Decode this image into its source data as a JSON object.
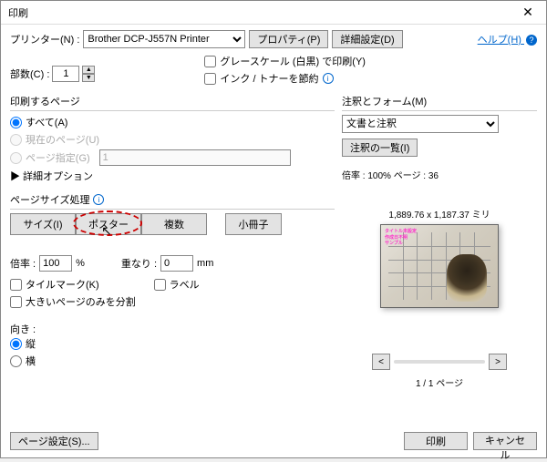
{
  "title": "印刷",
  "printer": {
    "label": "プリンター(N) :",
    "selected": "Brother DCP-J557N Printer",
    "props_btn": "プロパティ(P)",
    "adv_btn": "詳細設定(D)",
    "help": "ヘルプ(H)",
    "help_icon": "?"
  },
  "copies": {
    "label": "部数(C) :",
    "value": "1"
  },
  "options": {
    "grayscale": "グレースケール (白黒) で印刷(Y)",
    "save_ink": "インク / トナーを節約"
  },
  "pages": {
    "title": "印刷するページ",
    "all": "すべて(A)",
    "current": "現在のページ(U)",
    "range": "ページ指定(G)",
    "range_val": "1",
    "more": "▶ 詳細オプション"
  },
  "sizing": {
    "title": "ページサイズ処理",
    "size": "サイズ(I)",
    "poster": "ポスター",
    "multiple": "複数",
    "booklet": "小冊子",
    "zoom_label": "倍率 :",
    "zoom_val": "100",
    "zoom_pct": "%",
    "overlap_label": "重なり :",
    "overlap_val": "0",
    "overlap_unit": "mm",
    "tile_marks": "タイルマーク(K)",
    "labels": "ラベル",
    "big_only": "大きいページのみを分割"
  },
  "orient": {
    "title": "向き :",
    "portrait": "縦",
    "landscape": "横"
  },
  "annot": {
    "title": "注釈とフォーム(M)",
    "selected": "文書と注釈",
    "list_btn": "注釈の一覧(I)",
    "zoom_info": "倍率 : 100% ページ : 36"
  },
  "preview": {
    "dim": "1,889.76 x 1,187.37 ミリ",
    "pink1": "タイトル未設定",
    "pink2": "作成日不明",
    "pink3": "サンプル"
  },
  "nav": {
    "prev": "<",
    "next": ">",
    "page": "1 / 1 ページ"
  },
  "footer": {
    "page_setup": "ページ設定(S)...",
    "print": "印刷",
    "cancel": "キャンセル"
  }
}
